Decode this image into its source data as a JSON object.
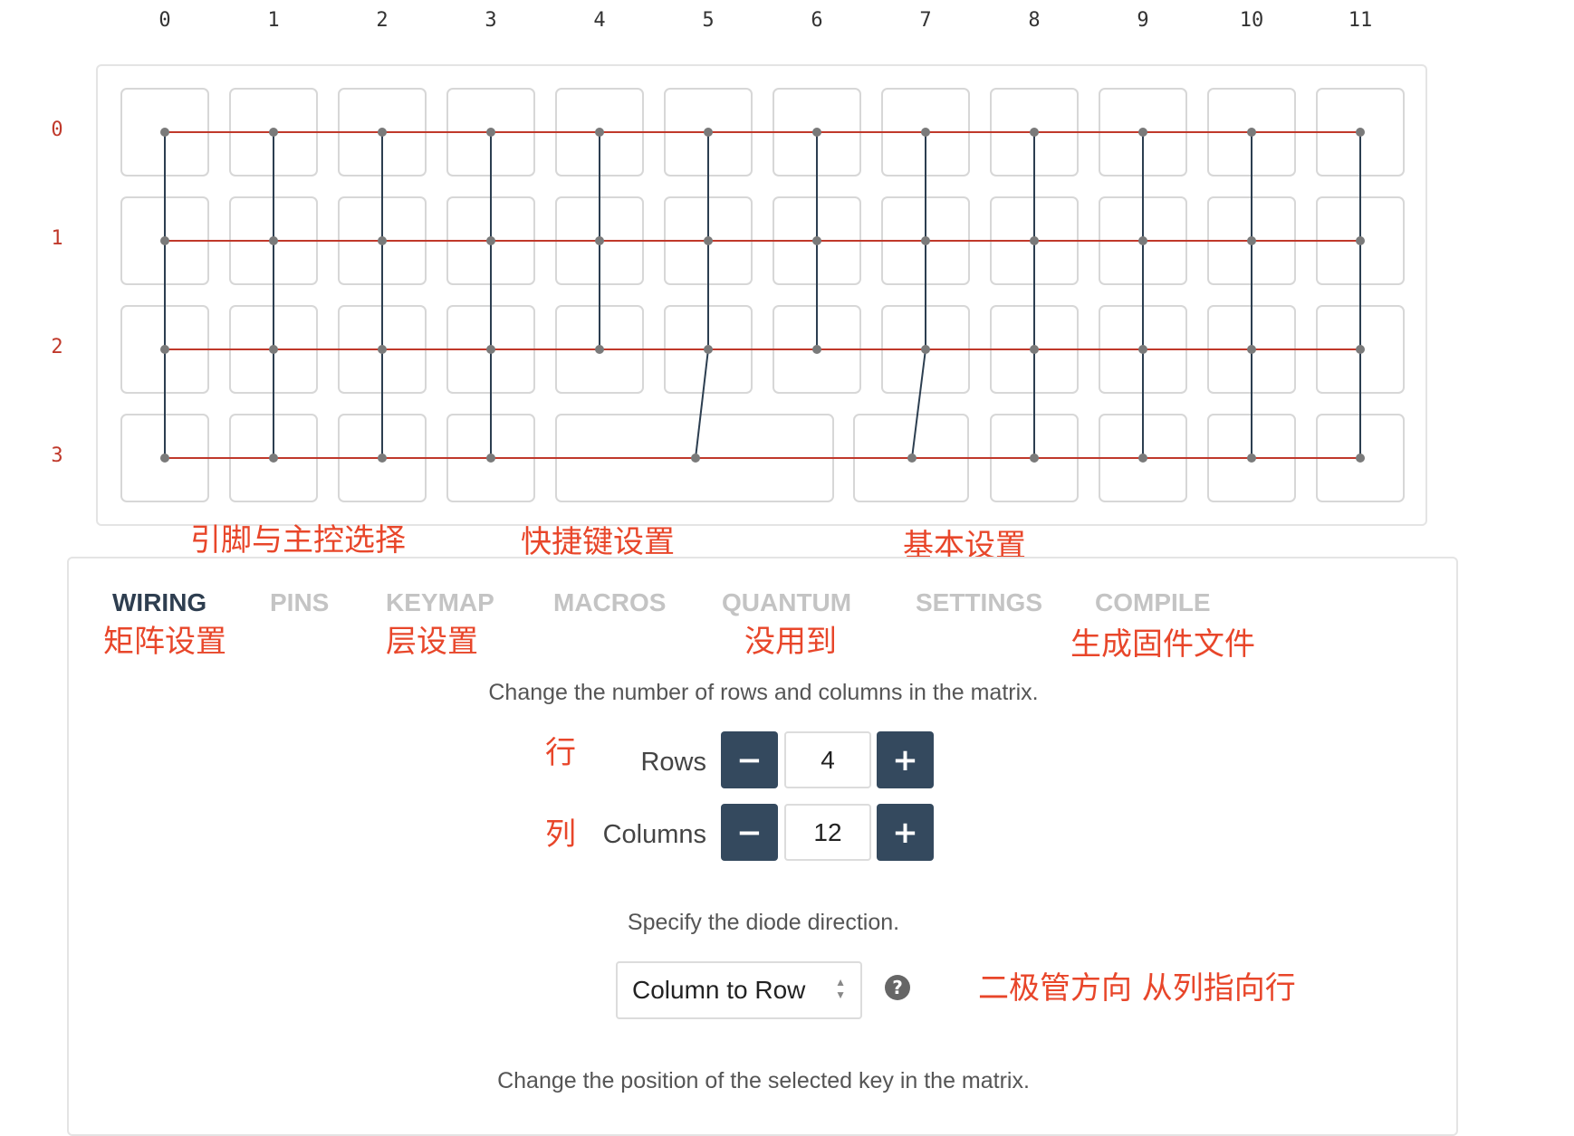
{
  "matrix": {
    "columns": [
      "0",
      "1",
      "2",
      "3",
      "4",
      "5",
      "6",
      "7",
      "8",
      "9",
      "10",
      "11"
    ],
    "rows": [
      "0",
      "1",
      "2",
      "3"
    ]
  },
  "annotations": {
    "pins": "引脚与主控选择",
    "keymap": "快捷键设置",
    "settings": "基本设置",
    "wiring": "矩阵设置",
    "keymap_layer": "层设置",
    "quantum": "没用到",
    "compile": "生成固件文件",
    "rows": "行",
    "columns": "列",
    "diode": "二极管方向 从列指向行"
  },
  "tabs": [
    {
      "label": "WIRING",
      "active": true
    },
    {
      "label": "PINS",
      "active": false
    },
    {
      "label": "KEYMAP",
      "active": false
    },
    {
      "label": "MACROS",
      "active": false
    },
    {
      "label": "QUANTUM",
      "active": false
    },
    {
      "label": "SETTINGS",
      "active": false
    },
    {
      "label": "COMPILE",
      "active": false
    }
  ],
  "wiring": {
    "matrix_description": "Change the number of rows and columns in the matrix.",
    "rows_label": "Rows",
    "rows_value": "4",
    "columns_label": "Columns",
    "columns_value": "12",
    "decrement_symbol": "−",
    "increment_symbol": "+",
    "diode_description": "Specify the diode direction.",
    "diode_value": "Column to Row",
    "help_symbol": "?",
    "position_description": "Change the position of the selected key in the matrix."
  },
  "colors": {
    "row_wire": "#c0392b",
    "column_wire": "#2c3e50",
    "node": "#7a7a7a",
    "annotation": "#e8462a",
    "button": "#34495e"
  }
}
